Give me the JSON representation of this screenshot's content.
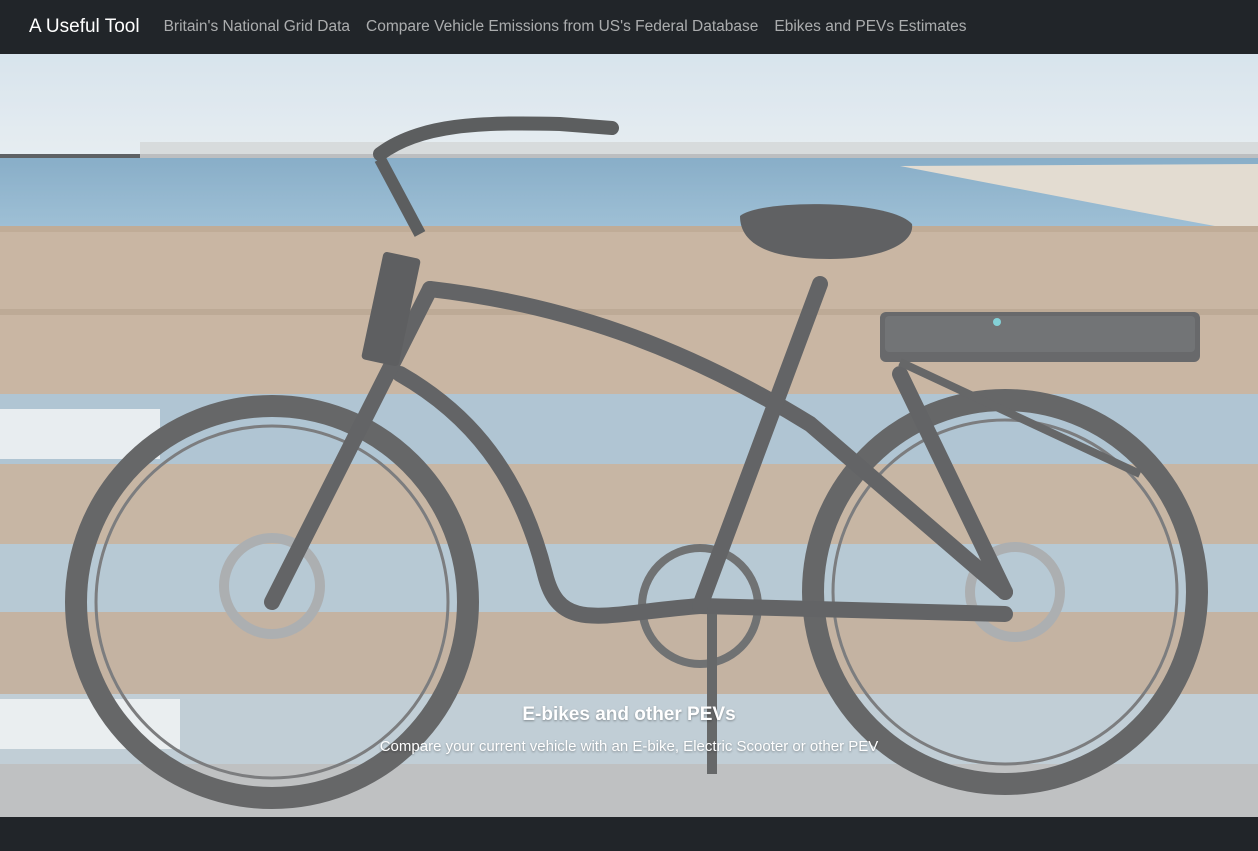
{
  "navbar": {
    "brand": "A Useful Tool",
    "links": [
      {
        "label": "Britain's National Grid Data"
      },
      {
        "label": "Compare Vehicle Emissions from US's Federal Database"
      },
      {
        "label": "Ebikes and PEVs Estimates"
      }
    ]
  },
  "hero": {
    "image_subject": "ebike-on-pier-photo",
    "title": "E-bikes and other PEVs",
    "subtitle": "Compare your current vehicle with an E-bike, Electric Scooter or other PEV"
  },
  "colors": {
    "navbar_bg": "#212529",
    "brand_text": "#ffffff",
    "nav_link_text": "#9a9da0"
  }
}
